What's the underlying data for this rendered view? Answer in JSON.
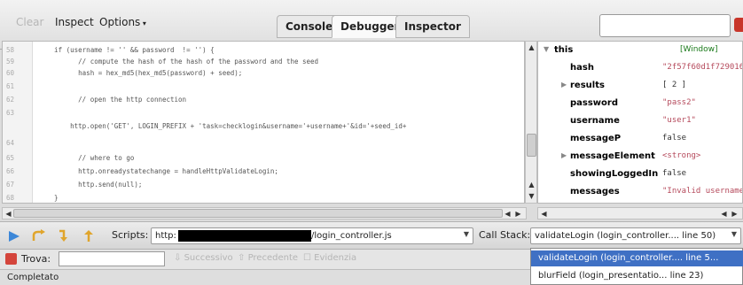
{
  "toolbar": {
    "clear_label": "Clear",
    "inspect_label": "Inspect",
    "options_label": "Options",
    "tabs": [
      "Console",
      "Debugger",
      "Inspector"
    ],
    "search_value": ""
  },
  "code": {
    "lines": [
      {
        "num": "58",
        "text": "    if (username != '' && password  != '') {"
      },
      {
        "num": "59",
        "text": "          // compute the hash of the hash of the password and the seed"
      },
      {
        "num": "60",
        "text": "          hash = hex_md5(hex_md5(password) + seed);"
      },
      {
        "num": "61",
        "text": ""
      },
      {
        "num": "62",
        "text": "          // open the http connection"
      },
      {
        "num": "63",
        "text": ""
      },
      {
        "num": "",
        "text": "        http.open('GET', LOGIN_PREFIX + 'task=checklogin&username='+username+'&id='+seed_id+"
      },
      {
        "num": "64",
        "text": ""
      },
      {
        "num": "65",
        "text": "          // where to go"
      },
      {
        "num": "66",
        "text": "          http.onreadystatechange = handleHttpValidateLogin;"
      },
      {
        "num": "67",
        "text": "          http.send(null);"
      },
      {
        "num": "68",
        "text": "    }"
      },
      {
        "num": "69",
        "text": "}"
      },
      {
        "num": "70",
        "text": ""
      }
    ]
  },
  "watch": {
    "rows": [
      {
        "name": "this",
        "value": "[Window]",
        "twisty": "▼",
        "value_color": "plain"
      },
      {
        "name": "hash",
        "value": "\"2f57f60d1f7290164\"",
        "twisty": "",
        "value_color": "str"
      },
      {
        "name": "results",
        "value": "[ 2 ]",
        "twisty": "▶",
        "value_color": "plain"
      },
      {
        "name": "password",
        "value": "\"pass2\"",
        "twisty": "",
        "value_color": "str"
      },
      {
        "name": "username",
        "value": "\"user1\"",
        "twisty": "",
        "value_color": "str"
      },
      {
        "name": "messageP",
        "value": "false",
        "twisty": "",
        "value_color": "plain"
      },
      {
        "name": "messageElement",
        "value": "<strong>",
        "twisty": "▶",
        "value_color": "str"
      },
      {
        "name": "showingLoggedIn",
        "value": "false",
        "twisty": "",
        "value_color": "plain"
      },
      {
        "name": "messages",
        "value": "\"Invalid username",
        "twisty": "",
        "value_color": "str"
      }
    ]
  },
  "scripts": {
    "label": "Scripts:",
    "value_prefix": "http:",
    "value_suffix": "/login_controller.js"
  },
  "callstack": {
    "label": "Call Stack:",
    "value": "validateLogin (login_controller.... line 50)",
    "items": [
      "validateLogin (login_controller.... line 5...",
      "blurField (login_presentatio... line 23)"
    ]
  },
  "find": {
    "label": "Trova:",
    "next_label": "Successivo",
    "prev_label": "Precedente",
    "highlight_label": "Evidenzia"
  },
  "status": {
    "text": "Completato"
  },
  "colors": {
    "selection": "#3f70c4",
    "string_value": "#b5495b"
  }
}
